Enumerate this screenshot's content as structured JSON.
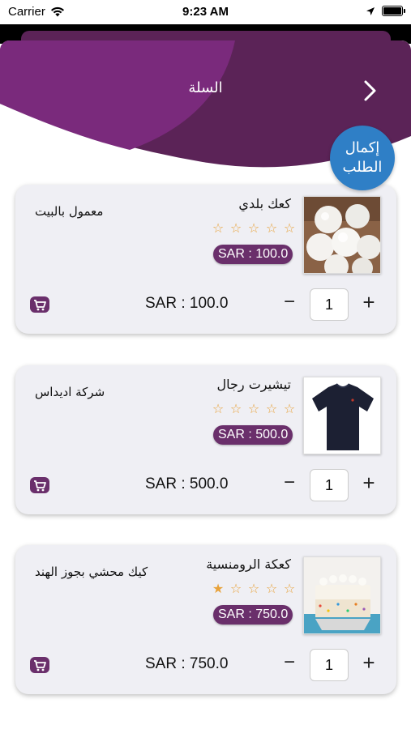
{
  "status_bar": {
    "carrier": "Carrier",
    "time": "9:23 AM"
  },
  "header": {
    "title": "السلة"
  },
  "checkout": {
    "line1": "إكمال",
    "line2": "الطلب"
  },
  "colors": {
    "brand_purple": "#6a2f6b",
    "header_purple": "#5b2357",
    "checkout_blue": "#2f7fc6",
    "star": "#e8a23a",
    "card_bg": "#efeff4"
  },
  "items": [
    {
      "name": "كعك بلدي",
      "store": "معمول بالبيت",
      "rating": 0,
      "price_badge": "SAR : 100.0",
      "total": "SAR : 100.0",
      "quantity": "1",
      "image": "cookies-image"
    },
    {
      "name": "تيشيرت رجال",
      "store": "شركة اديداس",
      "rating": 0,
      "price_badge": "SAR : 500.0",
      "total": "SAR : 500.0",
      "quantity": "1",
      "image": "tshirt-image"
    },
    {
      "name": "كعكة الرومنسية",
      "store": "كيك محشي بجوز الهند",
      "rating": 1,
      "price_badge": "SAR : 750.0",
      "total": "SAR : 750.0",
      "quantity": "1",
      "image": "cake-image"
    }
  ],
  "controls": {
    "minus": "−",
    "plus": "+"
  },
  "icons": {
    "back": "chevron-right-icon",
    "cart": "add-to-cart-icon",
    "star": "star-icon"
  }
}
